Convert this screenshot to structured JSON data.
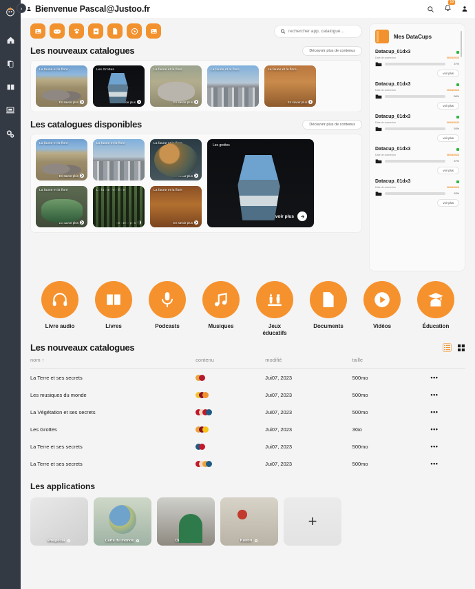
{
  "theme": {
    "accent": "#f2922f",
    "sidebar_bg": "#343a44",
    "page_bg": "#f4f4f4"
  },
  "sidebar": {
    "toggle": "›",
    "items": [
      {
        "name": "home-icon",
        "label": "Accueil"
      },
      {
        "name": "files-icon",
        "label": "Fichiers"
      },
      {
        "name": "book-icon",
        "label": "Catalogues"
      },
      {
        "name": "laptop-icon",
        "label": "Applications"
      },
      {
        "name": "settings-icon",
        "label": "Paramètres"
      }
    ]
  },
  "topbar": {
    "welcome": "Bienvenue Pascal@Justoo.fr",
    "user_icon": "user-icon",
    "search_icon": "search-icon",
    "bell_icon": "bell-icon",
    "bell_badge": "18",
    "account_icon": "account-icon"
  },
  "quick_launch": {
    "buttons": [
      {
        "name": "quick-image-button",
        "icon": "image-icon"
      },
      {
        "name": "quick-games-button",
        "icon": "gamepad-icon"
      },
      {
        "name": "quick-nature-button",
        "icon": "paw-icon"
      },
      {
        "name": "quick-add-book-button",
        "icon": "book-plus-icon"
      },
      {
        "name": "quick-document-button",
        "icon": "document-icon"
      },
      {
        "name": "quick-video-button",
        "icon": "play-icon"
      },
      {
        "name": "quick-gallery-button",
        "icon": "photo-icon"
      }
    ]
  },
  "search": {
    "placeholder": "rechercher app, catalogue…",
    "value": ""
  },
  "sections": {
    "new_catalogues": {
      "title": "Les nouveaux catalogues",
      "cta": "Découvrir plus de contenus",
      "cards": [
        {
          "title": "La faune et la flore",
          "cta": "En savoir plus",
          "image": "img-elephant"
        },
        {
          "title": "Les Grottes",
          "cta": "En savoir plus",
          "image": "img-cave"
        },
        {
          "title": "La faune et la flore",
          "cta": "En savoir plus",
          "image": "img-rhino"
        },
        {
          "title": "La faune et la flore",
          "cta": "En savoir plus",
          "image": "img-city"
        },
        {
          "title": "La faune et la flore",
          "cta": "En savoir plus",
          "image": "img-desert"
        }
      ]
    },
    "available_catalogues": {
      "title": "Les catalogues disponibles",
      "cta": "Découvrir plus de contenus",
      "cards": [
        {
          "title": "La faune et la flore",
          "cta": "En savoir plus",
          "image": "img-elephant"
        },
        {
          "title": "La faune et la flore",
          "cta": "En savoir plus",
          "image": "img-city"
        },
        {
          "title": "La faune et la flore",
          "cta": "En savoir plus",
          "image": "img-globe"
        },
        {
          "title": "La faune et la flore",
          "cta": "En savoir plus",
          "image": "img-pottery"
        },
        {
          "title": "La faune et la flore",
          "cta": "En savoir plus",
          "image": "img-forest"
        },
        {
          "title": "La faune et la flore",
          "cta": "En savoir plus",
          "image": "img-ground"
        }
      ],
      "featured": {
        "title": "Les grottes",
        "cta": "En savoir plus",
        "image": "img-cave"
      }
    },
    "table_section": {
      "title": "Les nouveaux catalogues",
      "view_list_icon": "list-view-icon",
      "view_grid_icon": "grid-view-icon",
      "columns": [
        "nom ↑",
        "contenu",
        "modifié",
        "taille",
        ""
      ],
      "rows": [
        {
          "nom": "La Terre et ses secrets",
          "contenu": [
            "#e8a33d",
            "#b5192e"
          ],
          "modifie": "Jui07, 2023",
          "taille": "500mo",
          "action": "•••"
        },
        {
          "nom": "Les musiques du monde",
          "contenu": [
            "#f1c232",
            "#8c1126",
            "#f2922f"
          ],
          "modifie": "Jui07, 2023",
          "taille": "500mo",
          "action": "•••"
        },
        {
          "nom": "La Végétation et ses secrets",
          "contenu": [
            "#c2182b",
            "#f0d9c0",
            "#c2182b",
            "#1f5a85"
          ],
          "modifie": "Jui07, 2023",
          "taille": "500mo",
          "action": "•••"
        },
        {
          "nom": "Les Grottes",
          "contenu": [
            "#e8a33d",
            "#8c1126",
            "#f5c518"
          ],
          "modifie": "Jui07, 2023",
          "taille": "3Go",
          "action": "•••"
        },
        {
          "nom": "La Terre et ses secrets",
          "contenu": [
            "#1f5a85",
            "#c2182b"
          ],
          "modifie": "Jui07, 2023",
          "taille": "500mo",
          "action": "•••"
        },
        {
          "nom": "La Terre et ses secrets",
          "contenu": [
            "#c2182b",
            "#f0d9c0",
            "#e8a33d",
            "#1f5a85"
          ],
          "modifie": "Jui07, 2023",
          "taille": "500mo",
          "action": "•••"
        }
      ]
    },
    "applications": {
      "title": "Les applications",
      "add_label": "+",
      "items": [
        {
          "label": "Wikipédia",
          "image": "img-wiki"
        },
        {
          "label": "Carte du monde",
          "image": "img-map"
        },
        {
          "label": "OmekaS",
          "image": "img-class"
        },
        {
          "label": "Kolibri",
          "image": "img-kolibri"
        }
      ]
    }
  },
  "categories": [
    {
      "label": "Livre audio",
      "icon": "headphones-icon"
    },
    {
      "label": "Livres",
      "icon": "book-open-icon"
    },
    {
      "label": "Podcasts",
      "icon": "microphone-icon"
    },
    {
      "label": "Musiques",
      "icon": "music-note-icon"
    },
    {
      "label": "Jeux\néducatifs",
      "icon": "chess-icon"
    },
    {
      "label": "Documents",
      "icon": "file-icon"
    },
    {
      "label": "Vidéos",
      "icon": "play-circle-icon"
    },
    {
      "label": "Éducation",
      "icon": "graduation-icon"
    }
  ],
  "datacups": {
    "title": "Mes DataCups",
    "connection_label": "Date de connexion",
    "more_label": "voir plus",
    "items": [
      {
        "name": "Datacup_01dx3",
        "date": "06/04/2023",
        "percent": "37%",
        "fill": 37,
        "color": "#2db742",
        "status": "#2db742"
      },
      {
        "name": "Datacup_01dx3",
        "date": "06/04/2023",
        "percent": "56%",
        "fill": 56,
        "color": "#2db742",
        "status": "#2db742"
      },
      {
        "name": "Datacup_01dx3",
        "date": "06/04/2023",
        "percent": "93%",
        "fill": 93,
        "color": "#f2922f",
        "status": "#2db742"
      },
      {
        "name": "Datacup_01dx3",
        "date": "06/04/2023",
        "percent": "37%",
        "fill": 37,
        "color": "#2db742",
        "status": "#2db742"
      },
      {
        "name": "Datacup_01dx3",
        "date": "06/04/2023",
        "percent": "93%",
        "fill": 93,
        "color": "#c0281a",
        "status": "#2db742"
      }
    ]
  }
}
